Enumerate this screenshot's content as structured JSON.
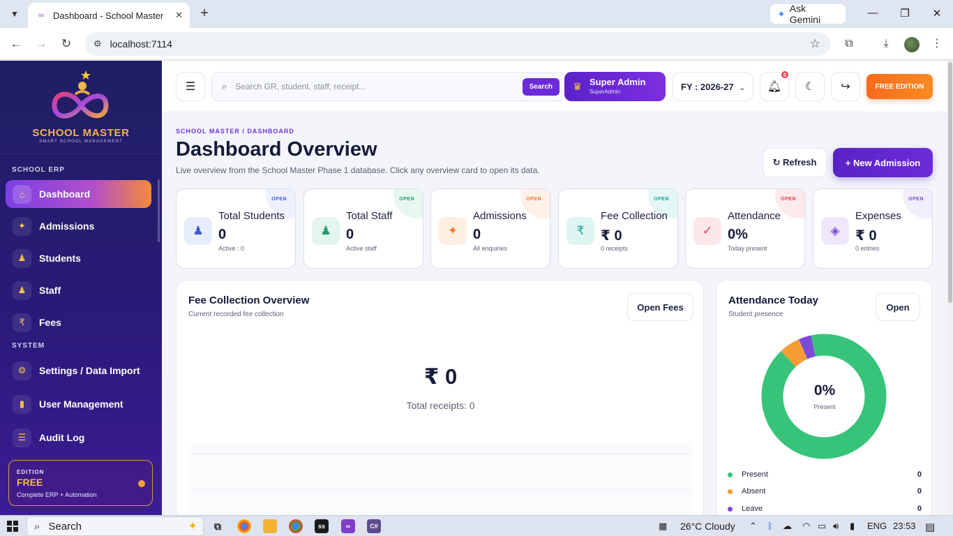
{
  "browser": {
    "tab_title": "Dashboard - School Master",
    "url": "localhost:7114",
    "gemini_label": "Ask Gemini"
  },
  "sidebar": {
    "brand": "SCHOOL MASTER",
    "brand_sub": "SMART SCHOOL MANAGEMENT",
    "section_erp": "SCHOOL ERP",
    "section_system": "SYSTEM",
    "items": [
      {
        "label": "Dashboard",
        "icon": "home-icon",
        "glyph": "⌂"
      },
      {
        "label": "Admissions",
        "icon": "sparkle-icon",
        "glyph": "✦"
      },
      {
        "label": "Students",
        "icon": "person-icon",
        "glyph": "♟"
      },
      {
        "label": "Staff",
        "icon": "person-icon",
        "glyph": "♟"
      },
      {
        "label": "Fees",
        "icon": "rupee-icon",
        "glyph": "₹"
      },
      {
        "label": "Settings / Data Import",
        "icon": "gear-icon",
        "glyph": "⚙"
      },
      {
        "label": "User Management",
        "icon": "briefcase-icon",
        "glyph": "▮"
      },
      {
        "label": "Audit Log",
        "icon": "list-icon",
        "glyph": "☰"
      }
    ],
    "edition": {
      "label": "EDITION",
      "value": "FREE",
      "desc": "Complete ERP + Automation"
    }
  },
  "topbar": {
    "search_placeholder": "Search GR, student, staff, receipt...",
    "search_button": "Search",
    "user_name": "Super Admin",
    "user_role": "SuperAdmin",
    "fy": "FY : 2026-27",
    "notifications": "0",
    "free_edition": "FREE EDITION"
  },
  "page": {
    "breadcrumb": "SCHOOL MASTER / DASHBOARD",
    "title": "Dashboard Overview",
    "subtitle": "Live overview from the School Master Phase 1 database. Click any overview card to open its data.",
    "refresh": "↻ Refresh",
    "new_admission": "+  New Admission"
  },
  "cards": [
    {
      "title": "Total Students",
      "value": "0",
      "sub": "Active : 0",
      "open": "OPEN",
      "icon": "student-icon",
      "glyph": "♟",
      "color": "#3b5bdb",
      "bg": "#e8edfb",
      "corner": "#eef1fc"
    },
    {
      "title": "Total Staff",
      "value": "0",
      "sub": "Active staff",
      "open": "OPEN",
      "icon": "staff-icon",
      "glyph": "♟",
      "color": "#1f9d6b",
      "bg": "#e3f5ec",
      "corner": "#e8f7ef"
    },
    {
      "title": "Admissions",
      "value": "0",
      "sub": "All enquiries",
      "open": "OPEN",
      "icon": "sparkle-icon",
      "glyph": "✦",
      "color": "#f0762a",
      "bg": "#fdeee2",
      "corner": "#fef2e8"
    },
    {
      "title": "Fee Collection",
      "value": "₹ 0",
      "sub": "0 receipts",
      "open": "OPEN",
      "icon": "rupee-icon",
      "glyph": "₹",
      "color": "#15a39a",
      "bg": "#dff5f2",
      "corner": "#e4f7f5"
    },
    {
      "title": "Attendance",
      "value": "0%",
      "sub": "Today present",
      "open": "OPEN",
      "icon": "check-icon",
      "glyph": "✓",
      "color": "#e53950",
      "bg": "#fde7ea",
      "corner": "#fdeaed"
    },
    {
      "title": "Expenses",
      "value": "₹ 0",
      "sub": "0 entries",
      "open": "OPEN",
      "icon": "diamond-icon",
      "glyph": "◈",
      "color": "#7b4ad9",
      "bg": "#efe8fb",
      "corner": "#f3eefc"
    }
  ],
  "fee_panel": {
    "title": "Fee Collection Overview",
    "subtitle": "Current recorded fee collection",
    "button": "Open Fees",
    "amount": "₹ 0",
    "receipts": "Total receipts: 0"
  },
  "attendance_panel": {
    "title": "Attendance Today",
    "subtitle": "Student presence",
    "button": "Open",
    "percent": "0%",
    "percent_label": "Present",
    "donut_fractions": [
      {
        "name": "Present",
        "fraction": 0.912,
        "color": "#37c47a"
      },
      {
        "name": "Absent",
        "fraction": 0.055,
        "color": "#f59b34"
      },
      {
        "name": "Leave",
        "fraction": 0.033,
        "color": "#7b4ad9"
      }
    ],
    "legend": [
      {
        "name": "Present",
        "value": "0",
        "color": "#37c47a"
      },
      {
        "name": "Absent",
        "value": "0",
        "color": "#f59b34"
      },
      {
        "name": "Leave",
        "value": "0",
        "color": "#7b4ad9"
      }
    ]
  },
  "taskbar": {
    "search": "Search",
    "weather": "26°C  Cloudy",
    "lang": "ENG",
    "time": "23:53"
  }
}
